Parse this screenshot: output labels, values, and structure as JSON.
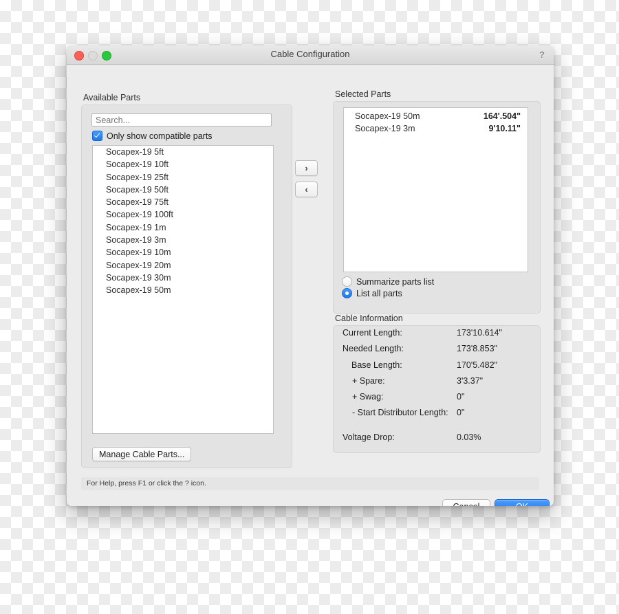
{
  "window": {
    "title": "Cable Configuration",
    "help_icon": "question-mark-icon",
    "traffic_lights": [
      "close",
      "minimize",
      "zoom"
    ]
  },
  "available_parts": {
    "group_label": "Available Parts",
    "search": {
      "value": "",
      "placeholder": "Search..."
    },
    "compatible_checkbox": {
      "label": "Only show compatible parts",
      "checked": true
    },
    "items": [
      "Socapex-19 5ft",
      "Socapex-19 10ft",
      "Socapex-19 25ft",
      "Socapex-19 50ft",
      "Socapex-19 75ft",
      "Socapex-19 100ft",
      "Socapex-19 1m",
      "Socapex-19 3m",
      "Socapex-19 10m",
      "Socapex-19 20m",
      "Socapex-19 30m",
      "Socapex-19 50m"
    ],
    "manage_button": "Manage Cable Parts..."
  },
  "transfer": {
    "add_label": "›",
    "remove_label": "‹"
  },
  "selected_parts": {
    "group_label": "Selected Parts",
    "items": [
      {
        "name": "Socapex-19 50m",
        "length": "164'.504\""
      },
      {
        "name": "Socapex-19 3m",
        "length": "9'10.11\""
      }
    ],
    "display_mode": {
      "options": [
        "Summarize parts list",
        "List all parts"
      ],
      "selected": "List all parts"
    }
  },
  "cable_information": {
    "group_label": "Cable Information",
    "rows": [
      {
        "label": "Current Length:",
        "value": "173'10.614\"",
        "indent": 0
      },
      {
        "label": "Needed Length:",
        "value": "173'8.853\"",
        "indent": 0
      },
      {
        "label": "Base Length:",
        "value": "170'5.482\"",
        "indent": 1
      },
      {
        "label": "+  Spare:",
        "value": "3'3.37\"",
        "indent": 2
      },
      {
        "label": "+  Swag:",
        "value": "0\"",
        "indent": 2
      },
      {
        "label": "-  Start Distributor Length:",
        "value": "0\"",
        "indent": 2
      },
      {
        "label": "Voltage Drop:",
        "value": "0.03%",
        "indent": 0
      }
    ]
  },
  "footer": {
    "status_text": "For Help, press F1 or click the ? icon.",
    "cancel_label": "Cancel",
    "ok_label": "OK"
  },
  "colors": {
    "accent_blue": "#1d78ec",
    "window_bg": "#ececec",
    "group_bg": "#e3e3e3",
    "list_bg": "#ffffff"
  }
}
